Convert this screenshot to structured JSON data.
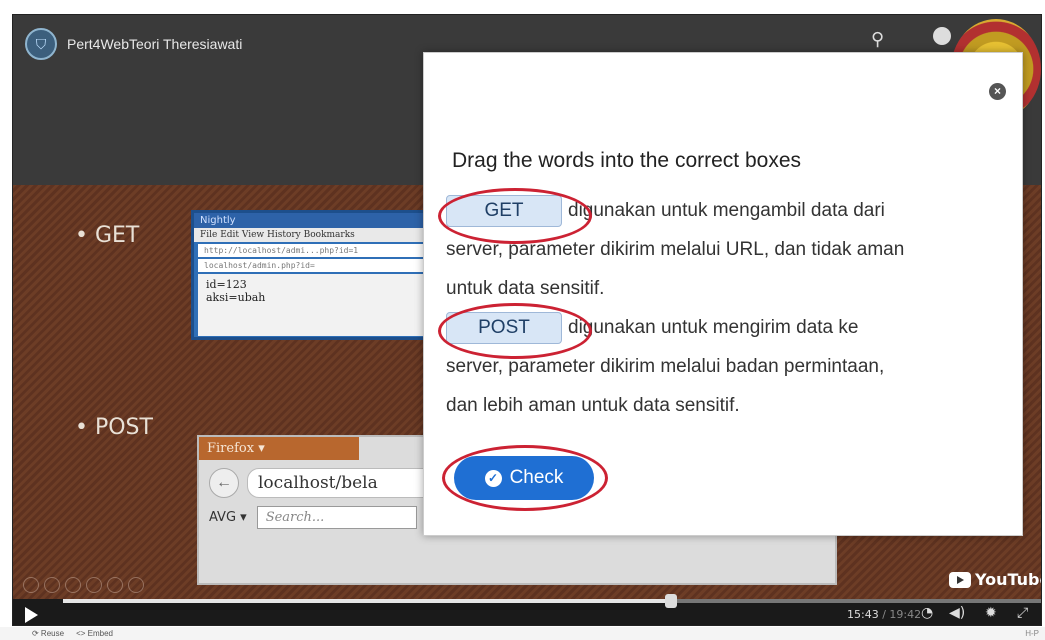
{
  "video": {
    "title": "Pert4WebTeori Theresiawati",
    "channel_icon": "shield-logo"
  },
  "slide": {
    "bullets": [
      "• GET",
      "• POST"
    ],
    "screenshot1": {
      "title": "Nightly",
      "menu": "File   Edit   View   History   Bookmarks",
      "url_line1": "http://localhost/admi...php?id=1",
      "url_line2": "localhost/admin.php?id=",
      "body_line1": "id=123",
      "body_line2": "aksi=ubah"
    },
    "screenshot2": {
      "tab": "Firefox ▾",
      "url": "localhost/bela",
      "avg": "AVG ▾",
      "search_placeholder": "Search..."
    }
  },
  "modal": {
    "title": "Drag the words into the correct boxes",
    "get_word": "GET",
    "get_text_1": "digunakan untuk mengambil data dari",
    "get_text_2": "server, parameter dikirim melalui URL, dan tidak aman",
    "get_text_3": "untuk data sensitif.",
    "post_word": "POST",
    "post_text_1": "digunakan untuk mengirim data ke",
    "post_text_2": "server, parameter dikirim melalui badan permintaan,",
    "post_text_3": "dan lebih aman untuk data sensitif.",
    "check_label": "Check",
    "annotation_color": "#cc2233"
  },
  "player": {
    "logo_text": "YouTube",
    "current_time": "15:43",
    "duration": "/ 19:42",
    "progress_fraction": 0.62
  },
  "footer": {
    "reuse": "⟳ Reuse",
    "embed": "<> Embed",
    "brand": "H-P"
  }
}
